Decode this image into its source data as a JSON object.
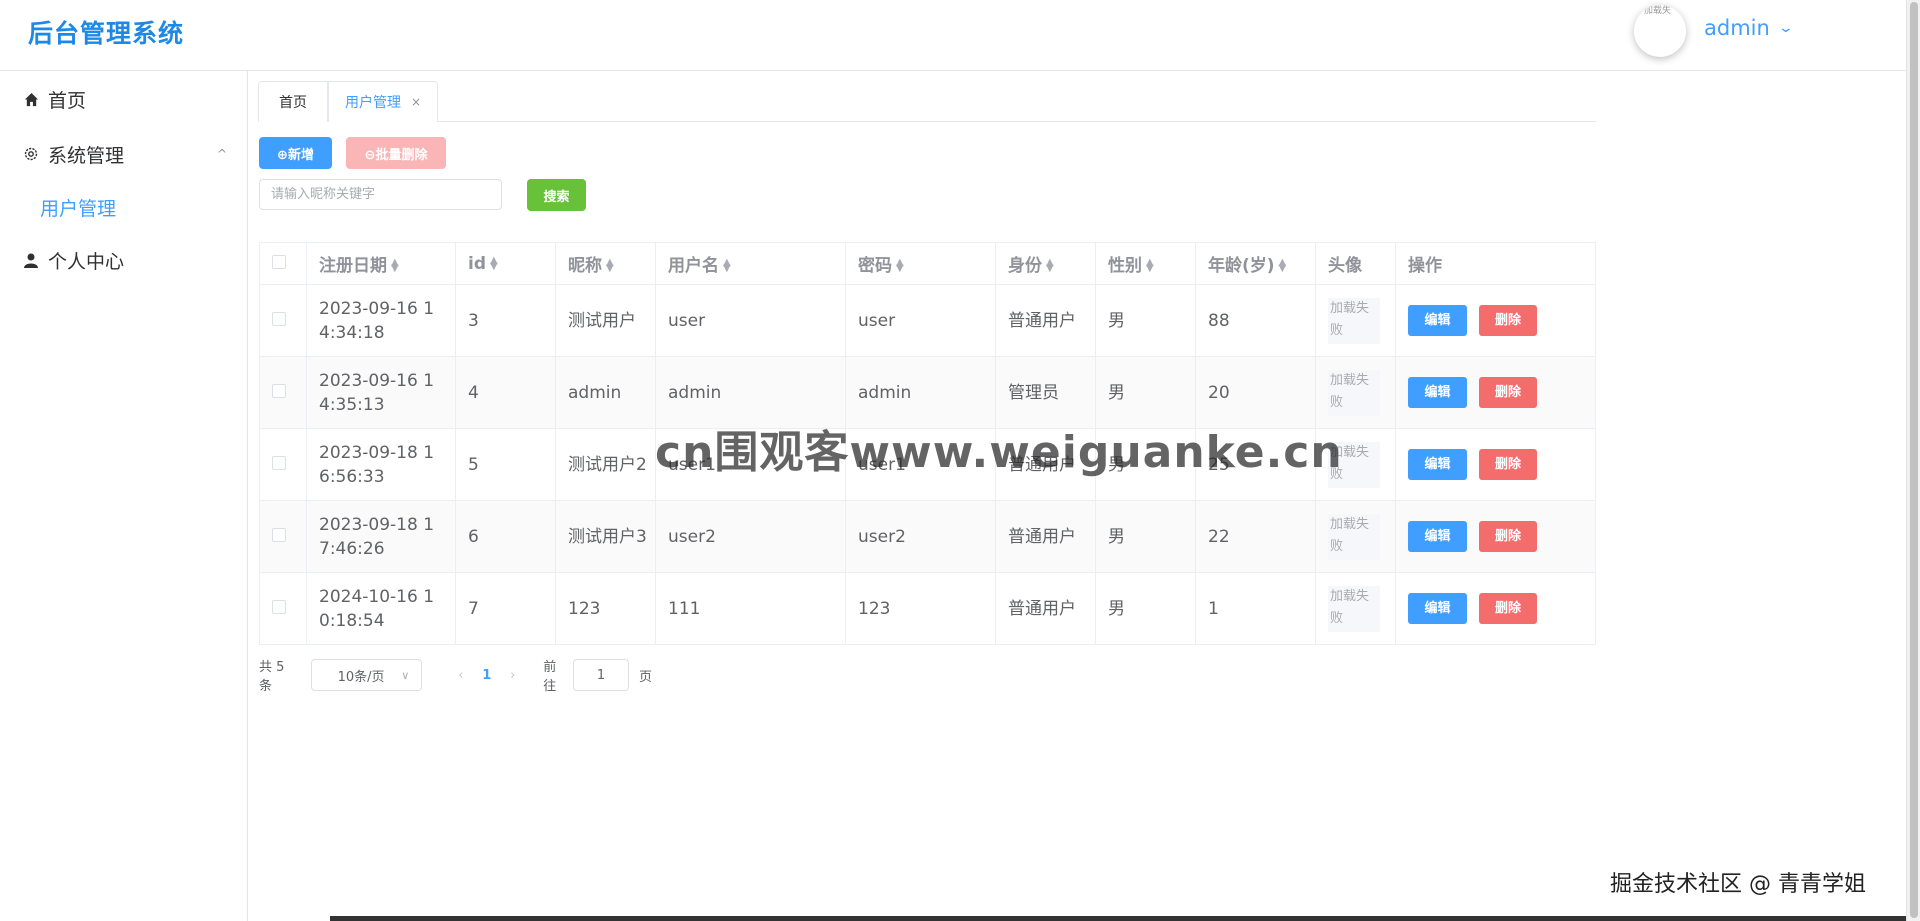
{
  "header": {
    "logo": "后台管理系统",
    "avatar_alt": "加载失",
    "username": "admin",
    "chevron_icon": "chevron-down-icon"
  },
  "sidebar": {
    "items": [
      {
        "label": "首页",
        "icon": "home-icon"
      },
      {
        "label": "系统管理",
        "icon": "gear-icon",
        "expanded": true
      },
      {
        "label": "用户管理",
        "active": true
      },
      {
        "label": "个人中心",
        "icon": "user-icon"
      }
    ]
  },
  "tabs": [
    {
      "label": "首页"
    },
    {
      "label": "用户管理",
      "closable": true
    }
  ],
  "toolbar": {
    "add_label": "⊕新增",
    "batch_delete_label": "⊖批量删除",
    "search_placeholder": "请输入昵称关键字",
    "search_label": "搜索"
  },
  "table": {
    "columns": [
      "注册日期",
      "id",
      "昵称",
      "用户名",
      "密码",
      "身份",
      "性别",
      "年龄(岁)",
      "头像",
      "操作"
    ],
    "rows": [
      {
        "date": "2023-09-16 14:34:18",
        "id": "3",
        "nickname": "测试用户",
        "username": "user",
        "password": "user",
        "role": "普通用户",
        "gender": "男",
        "age": "88",
        "avatar": "加载失败"
      },
      {
        "date": "2023-09-16 14:35:13",
        "id": "4",
        "nickname": "admin",
        "username": "admin",
        "password": "admin",
        "role": "管理员",
        "gender": "男",
        "age": "20",
        "avatar": "加载失败"
      },
      {
        "date": "2023-09-18 16:56:33",
        "id": "5",
        "nickname": "测试用户2",
        "username": "user1",
        "password": "user1",
        "role": "普通用户",
        "gender": "男",
        "age": "25",
        "avatar": "加载失败"
      },
      {
        "date": "2023-09-18 17:46:26",
        "id": "6",
        "nickname": "测试用户3",
        "username": "user2",
        "password": "user2",
        "role": "普通用户",
        "gender": "男",
        "age": "22",
        "avatar": "加载失败"
      },
      {
        "date": "2024-10-16 10:18:54",
        "id": "7",
        "nickname": "123",
        "username": "111",
        "password": "123",
        "role": "普通用户",
        "gender": "男",
        "age": "1",
        "avatar": "加载失败"
      }
    ],
    "edit_label": "编辑",
    "delete_label": "删除"
  },
  "pagination": {
    "total": "共 5 条",
    "page_size": "10条/页",
    "current_page": "1",
    "goto_label": "前往",
    "goto_value": "1",
    "page_suffix": "页"
  },
  "overlays": {
    "watermark": "cn围观客www.weiguanke.cn",
    "credit": "掘金技术社区 @ 青青学姐"
  },
  "colors": {
    "primary": "#409eff",
    "danger": "#f56c6c",
    "success": "#67c23a",
    "logo": "#1e88e5"
  }
}
